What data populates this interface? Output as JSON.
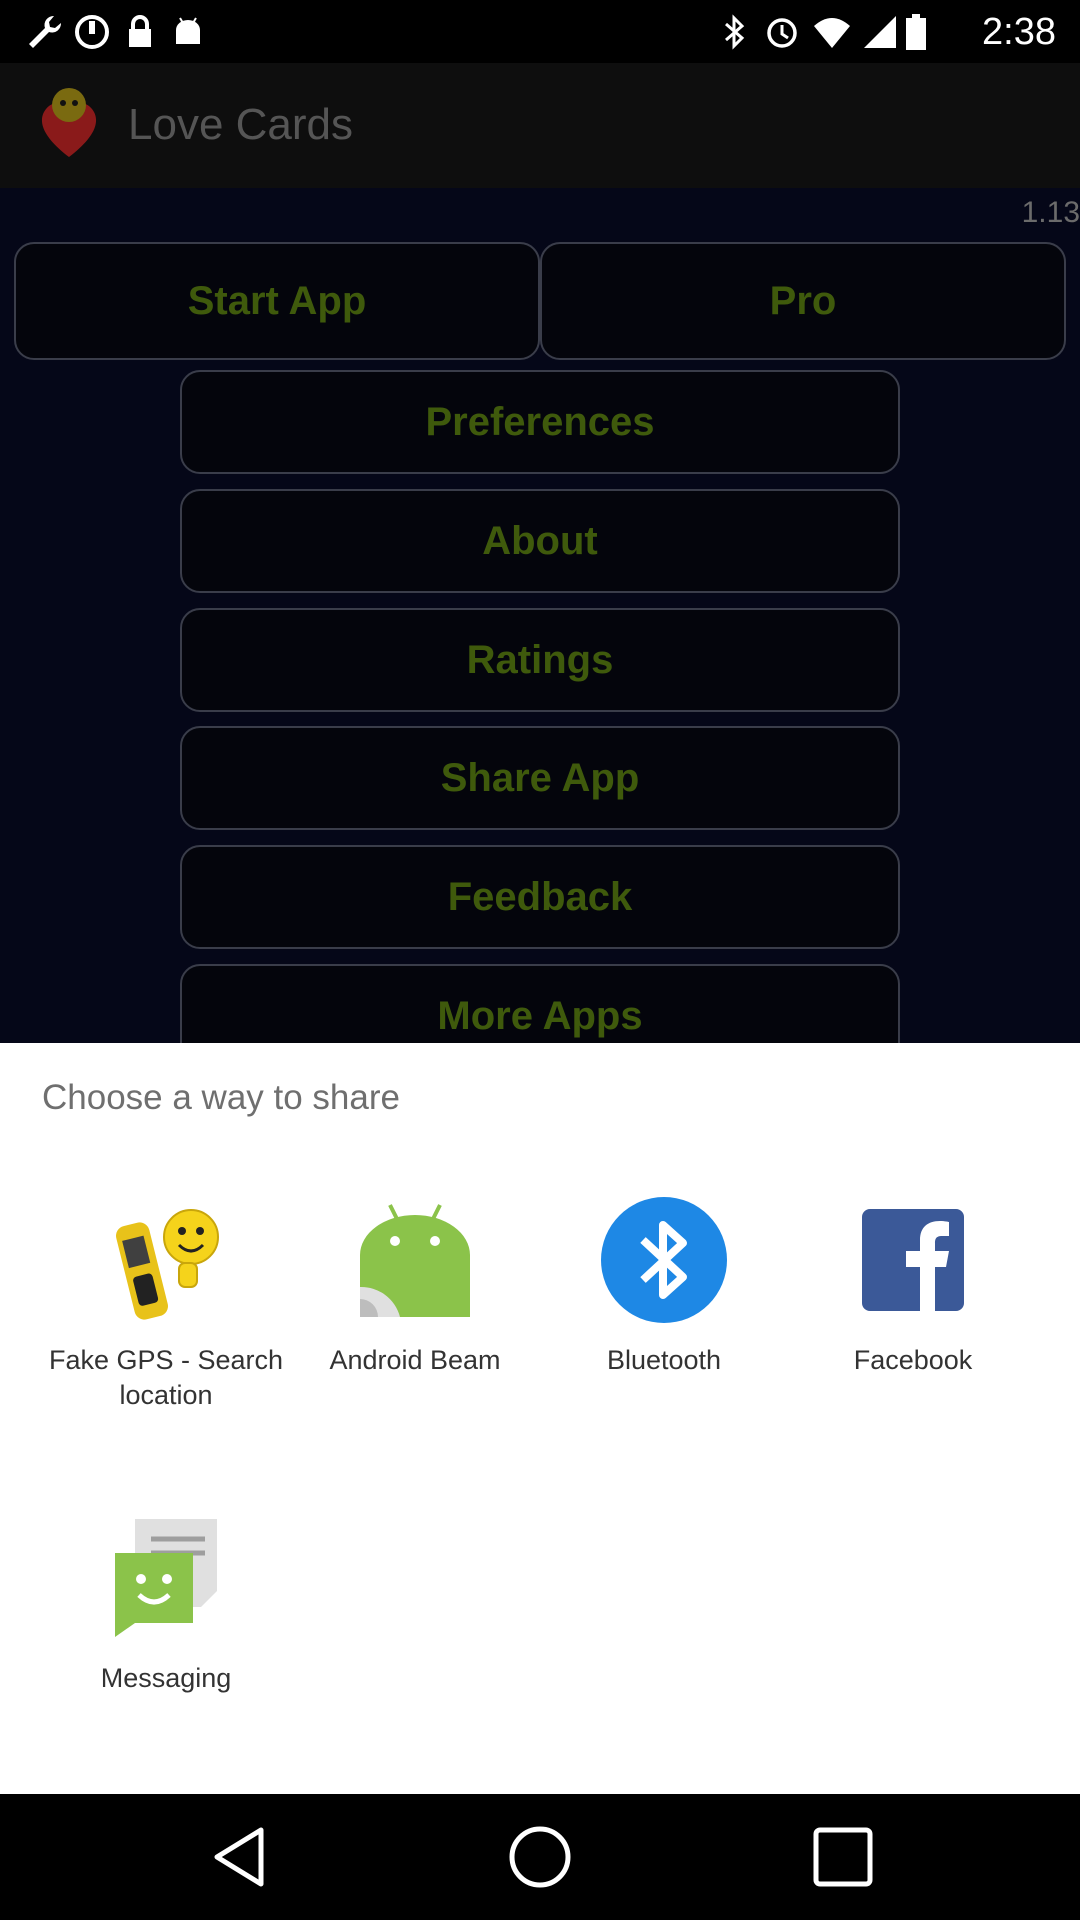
{
  "status_bar": {
    "time": "2:38",
    "left_icons": [
      "wrench-icon",
      "sync-icon",
      "lock-icon",
      "android-icon"
    ],
    "right_icons": [
      "bluetooth-icon",
      "alarm-icon",
      "wifi-icon",
      "signal-icon",
      "battery-icon"
    ]
  },
  "app_bar": {
    "title": "Love Cards"
  },
  "main": {
    "version": "1.13",
    "buttons": {
      "start_app": "Start App",
      "pro": "Pro",
      "preferences": "Preferences",
      "about": "About",
      "ratings": "Ratings",
      "share_app": "Share App",
      "feedback": "Feedback",
      "more_apps": "More Apps"
    },
    "button_text_color": "#3f5a0c"
  },
  "share_sheet": {
    "title": "Choose a way to share",
    "apps": [
      {
        "label": "Fake GPS - Search location",
        "icon": "fake-gps-icon"
      },
      {
        "label": "Android Beam",
        "icon": "android-beam-icon"
      },
      {
        "label": "Bluetooth",
        "icon": "bluetooth-icon",
        "color": "#1e88e5"
      },
      {
        "label": "Facebook",
        "icon": "facebook-icon",
        "color": "#3b5998"
      },
      {
        "label": "Messaging",
        "icon": "messaging-icon",
        "color": "#8bc34a"
      }
    ]
  },
  "nav_bar": {
    "buttons": [
      "back-icon",
      "home-icon",
      "recents-icon"
    ]
  }
}
